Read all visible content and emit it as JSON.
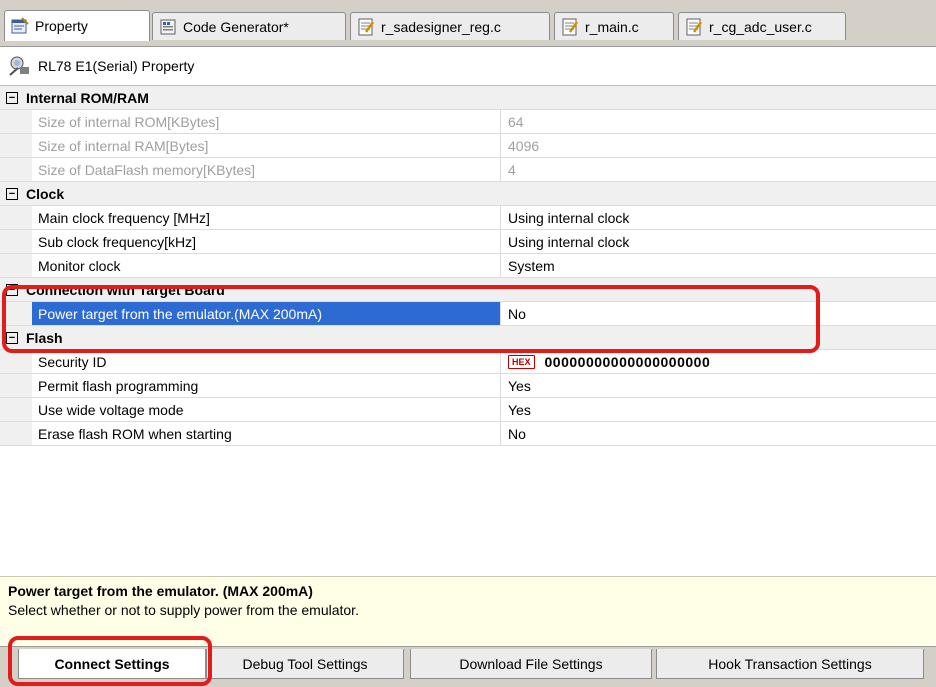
{
  "doc_tabs": [
    {
      "label": "Property",
      "icon": "property-sheet-icon",
      "active": true
    },
    {
      "label": "Code Generator*",
      "icon": "code-generator-icon",
      "active": false
    },
    {
      "label": "r_sadesigner_reg.c",
      "icon": "c-file-icon",
      "active": false
    },
    {
      "label": "r_main.c",
      "icon": "c-file-icon",
      "active": false
    },
    {
      "label": "r_cg_adc_user.c",
      "icon": "c-file-icon",
      "active": false
    }
  ],
  "panel_title": "RL78 E1(Serial) Property",
  "categories": {
    "rom_ram": {
      "label": "Internal ROM/RAM",
      "rows": [
        {
          "name": "Size of internal ROM[KBytes]",
          "value": "64"
        },
        {
          "name": "Size of internal RAM[Bytes]",
          "value": "4096"
        },
        {
          "name": "Size of DataFlash memory[KBytes]",
          "value": "4"
        }
      ]
    },
    "clock": {
      "label": "Clock",
      "rows": [
        {
          "name": "Main clock frequency [MHz]",
          "value": "Using internal clock"
        },
        {
          "name": "Sub clock frequency[kHz]",
          "value": "Using internal clock"
        },
        {
          "name": "Monitor clock",
          "value": "System"
        }
      ]
    },
    "connection": {
      "label": "Connection with Target Board",
      "rows": [
        {
          "name": "Power target from the emulator.(MAX 200mA)",
          "value": "No"
        }
      ]
    },
    "flash": {
      "label": "Flash",
      "rows": [
        {
          "name": "Security ID",
          "badge": "HEX",
          "value": "00000000000000000000"
        },
        {
          "name": "Permit flash programming",
          "value": "Yes"
        },
        {
          "name": "Use wide voltage mode",
          "value": "Yes"
        },
        {
          "name": "Erase flash ROM when starting",
          "value": "No"
        }
      ]
    }
  },
  "description": {
    "title": "Power target from the emulator. (MAX 200mA)",
    "text": "Select whether or not to supply power from the emulator."
  },
  "bottom_tabs": [
    {
      "label": "Connect Settings",
      "active": true
    },
    {
      "label": "Debug Tool Settings",
      "active": false
    },
    {
      "label": "Download File Settings",
      "active": false
    },
    {
      "label": "Hook Transaction Settings",
      "active": false
    }
  ],
  "colors": {
    "selection": "#2d6ad2",
    "highlight": "#e21b1b",
    "description_bg": "#ffffe8"
  }
}
